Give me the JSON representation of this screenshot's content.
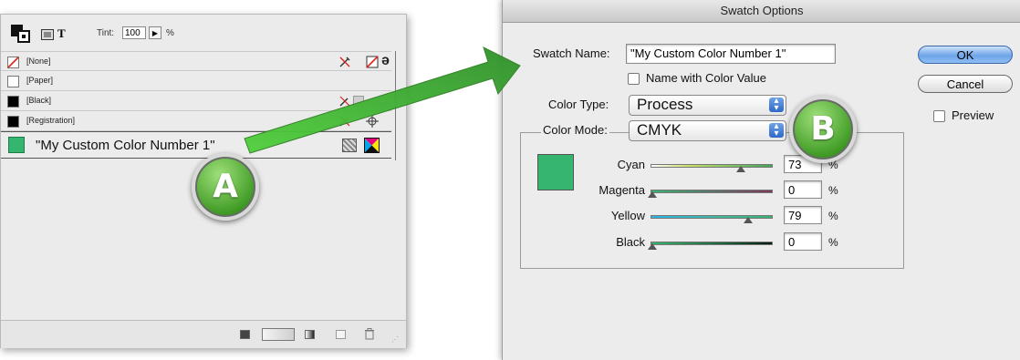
{
  "swatches_panel": {
    "tint_label": "Tint:",
    "tint_value": "100",
    "tint_unit": "%",
    "swatches": [
      {
        "name": "[None]"
      },
      {
        "name": "[Paper]"
      },
      {
        "name": "[Black]"
      },
      {
        "name": "[Registration]"
      },
      {
        "name": "\"My Custom Color Number 1\""
      }
    ]
  },
  "dialog": {
    "title": "Swatch Options",
    "swatch_name_label": "Swatch Name:",
    "swatch_name_value": "\"My Custom Color Number 1\"",
    "name_with_color_value_label": "Name with Color Value",
    "name_with_color_value_checked": false,
    "color_type_label": "Color Type:",
    "color_type_value": "Process",
    "color_mode_label": "Color Mode:",
    "color_mode_value": "CMYK",
    "channels": [
      {
        "label": "Cyan",
        "value": "73",
        "unit": "%"
      },
      {
        "label": "Magenta",
        "value": "0",
        "unit": "%"
      },
      {
        "label": "Yellow",
        "value": "79",
        "unit": "%"
      },
      {
        "label": "Black",
        "value": "0",
        "unit": "%"
      }
    ],
    "ok_label": "OK",
    "cancel_label": "Cancel",
    "preview_label": "Preview",
    "preview_checked": false
  },
  "callouts": {
    "a": "A",
    "b": "B"
  },
  "colors": {
    "custom_swatch": "#36b56e",
    "callout_green": "#3f9a24",
    "arrow_green": "#4cc23a"
  },
  "icons": [
    "swatch-fill-stroke-icon",
    "container-icon",
    "text-icon",
    "none-swatch-icon",
    "no-edit-icon",
    "registration-icon",
    "cmyk-process-icon",
    "new-swatch-icon",
    "trash-icon",
    "gradient-icon"
  ]
}
